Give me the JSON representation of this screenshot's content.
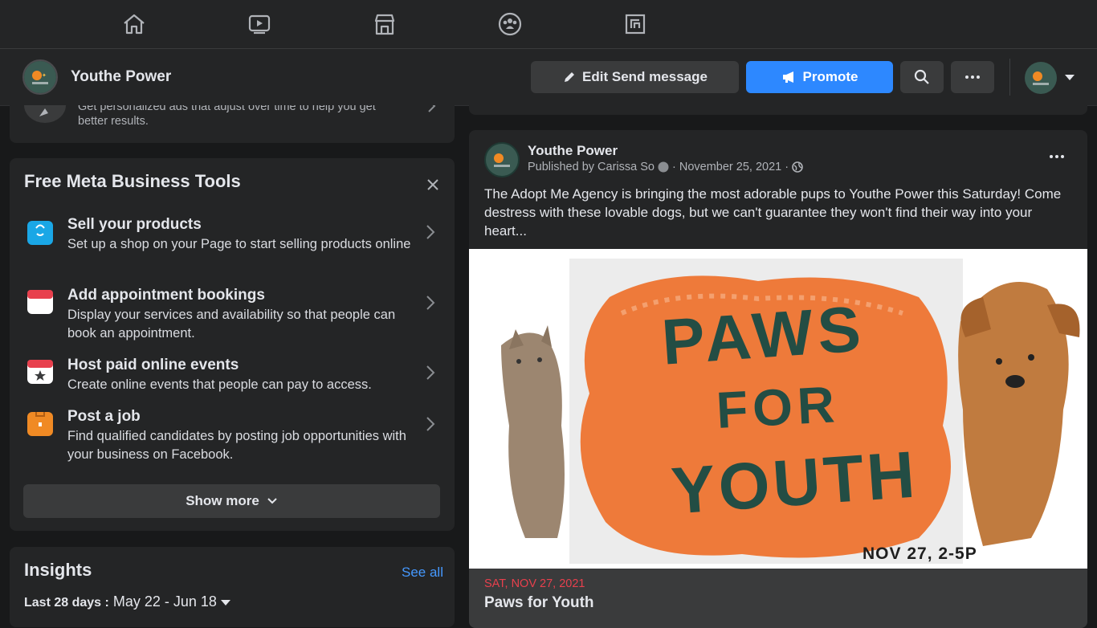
{
  "nav": {
    "icons": [
      "home-icon",
      "watch-icon",
      "marketplace-icon",
      "groups-icon",
      "gaming-icon"
    ]
  },
  "page": {
    "name": "Youthe Power",
    "edit_label": "Edit Send message",
    "promote_label": "Promote"
  },
  "ad_tip": {
    "text": "Get personalized ads that adjust over time to help you get better results."
  },
  "tools": {
    "title": "Free Meta Business Tools",
    "items": [
      {
        "title": "Sell your products",
        "desc": "Set up a shop on your Page to start selling products online",
        "icon": "shop-icon",
        "color": "#1aa7e6"
      },
      {
        "title": "Add appointment bookings",
        "desc": "Display your services and availability so that people can book an appointment.",
        "icon": "calendar-icon",
        "color": "#e8404d"
      },
      {
        "title": "Host paid online events",
        "desc": "Create online events that people can pay to access.",
        "icon": "event-icon",
        "color": "#e8404d"
      },
      {
        "title": "Post a job",
        "desc": "Find qualified candidates by posting job opportunities with your business on Facebook.",
        "icon": "briefcase-icon",
        "color": "#f08a24"
      }
    ],
    "show_more": "Show more"
  },
  "insights": {
    "title": "Insights",
    "see_all": "See all",
    "range_label": "Last 28 days :",
    "range_value": "May 22 - Jun 18"
  },
  "post": {
    "author": "Youthe Power",
    "published_by": "Published by Carissa So",
    "date": "November 25, 2021",
    "text": "The Adopt Me Agency is bringing the most adorable pups to Youthe Power this Saturday! Come destress with these lovable dogs, but we can't guarantee they won't find their way into your heart...",
    "image": {
      "line1": "PAWS",
      "line2": "FOR",
      "line3": "YOUTH",
      "date": "NOV 27, 2-5P"
    },
    "event_date": "SAT, NOV 27, 2021",
    "event_title": "Paws for Youth"
  },
  "colors": {
    "accent": "#2d88ff",
    "event_date": "#e8404d",
    "banner_orange": "#ee7a3a",
    "banner_text": "#234d44"
  }
}
